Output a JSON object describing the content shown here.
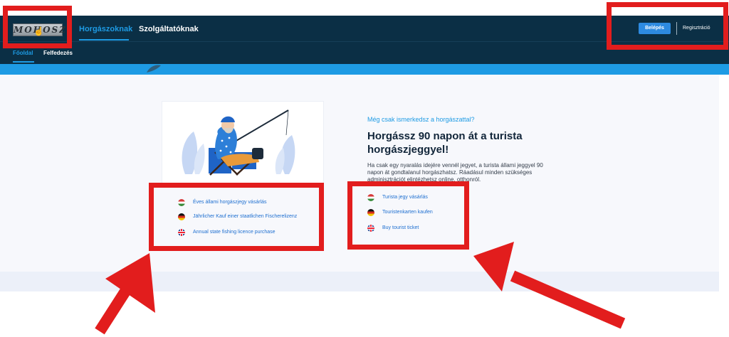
{
  "header": {
    "logo_text": "MOHOSZ",
    "nav": [
      {
        "label": "Horgászoknak",
        "active": true
      },
      {
        "label": "Szolgáltatóknak",
        "active": false
      }
    ],
    "login_label": "Belépés",
    "register_label": "Regisztráció"
  },
  "subnav": [
    {
      "label": "Főoldal",
      "active": true
    },
    {
      "label": "Felfedezés",
      "active": false
    }
  ],
  "intro": {
    "eyebrow": "Még csak ismerkedsz a horgászattal?",
    "headline": "Horgássz 90 napon át a turista horgászjeggyel!",
    "description": "Ha csak egy nyaralás idejére vennél jegyet, a turista állami jeggyel 90 napon át gondtalanul horgászhatsz. Ráadásul minden szükséges adminisztrációt elintézhetsz online, otthonról."
  },
  "annual_links": [
    {
      "flag": "hu-flag-icon",
      "label": "Éves állami horgászjegy vásárlás"
    },
    {
      "flag": "de-flag-icon",
      "label": "Jährlicher Kauf einer staatlichen Fischerelizenz"
    },
    {
      "flag": "gb-flag-icon",
      "label": "Annual state fishing licence purchase"
    }
  ],
  "tourist_links": [
    {
      "flag": "hu-flag-icon",
      "label": "Turista jegy vásárlás"
    },
    {
      "flag": "de-flag-icon",
      "label": "Touristenkarten kaufen"
    },
    {
      "flag": "gb-flag-icon",
      "label": "Buy tourist ticket"
    }
  ],
  "colors": {
    "header_bg": "#0b2f45",
    "accent": "#1e9be4",
    "annotation_red": "#e21d1d"
  }
}
